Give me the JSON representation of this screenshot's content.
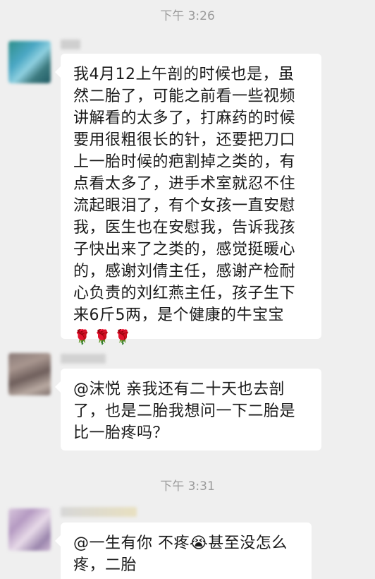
{
  "timestamps": [
    "下午 3:26",
    "下午 3:31"
  ],
  "messages": [
    {
      "text": "我4月12上午剖的时候也是，虽\n然二胎了，可能之前看一些视频\n讲解看的太多了，打麻药的时候\n要用很粗很长的针，还要把刀口\n上一胎时候的疤割掉之类的，有\n点看太多了，进手术室就忍不住\n流起眼泪了，有个女孩一直安慰\n我，医生也在安慰我，告诉我孩\n子快出来了之类的，感觉挺暖心\n的，感谢刘倩主任，感谢产检耐\n心负责的刘红燕主任，孩子生下\n来6斤5两，是个健康的牛宝宝",
      "emoji": "🌹🌹🌹"
    },
    {
      "text": "@沫悦 亲我还有二十天也去剖\n了，也是二胎我想问一下二胎是\n比一胎疼吗？"
    },
    {
      "text_before": "@一生有你 不疼",
      "emoji": "😭",
      "text_after": "甚至没怎么\n疼，二胎"
    }
  ],
  "colors": {
    "background": "#efefef",
    "bubble": "#ffffff",
    "timestamp": "#9b9b9b"
  }
}
